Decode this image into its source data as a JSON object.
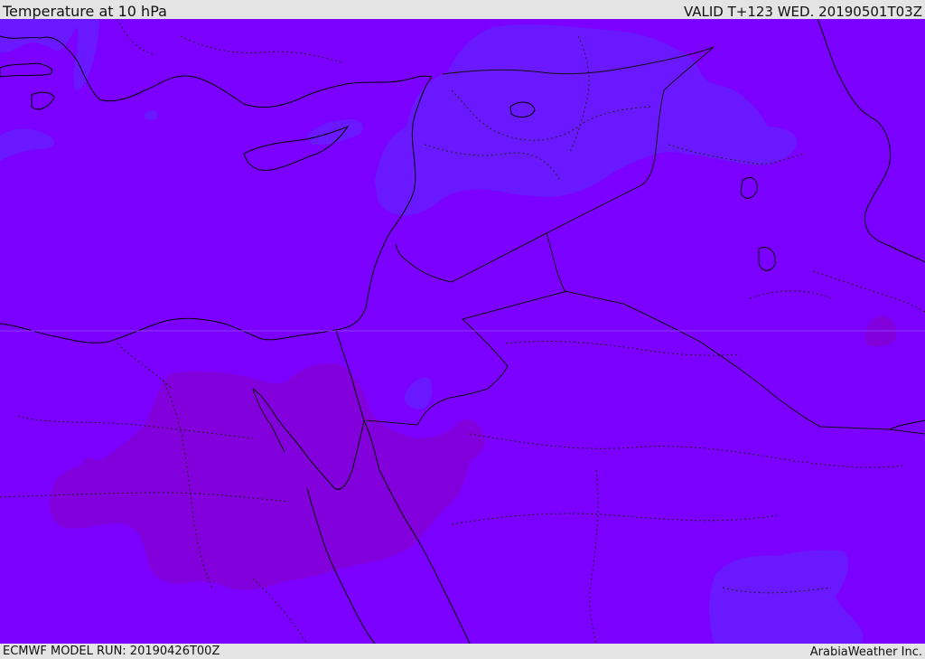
{
  "header": {
    "title": "Temperature at 10 hPa",
    "valid": "VALID T+123 WED. 20190501T03Z"
  },
  "footer": {
    "model_run": "ECMWF MODEL RUN: 20190426T00Z",
    "credit": "ArabiaWeather Inc."
  },
  "map": {
    "colors": {
      "base_field": "#7b00ff",
      "cooler_field": "#6a18ff",
      "warmer_field": "#8200db",
      "coastline": "#000000",
      "border": "#1a0033"
    }
  }
}
